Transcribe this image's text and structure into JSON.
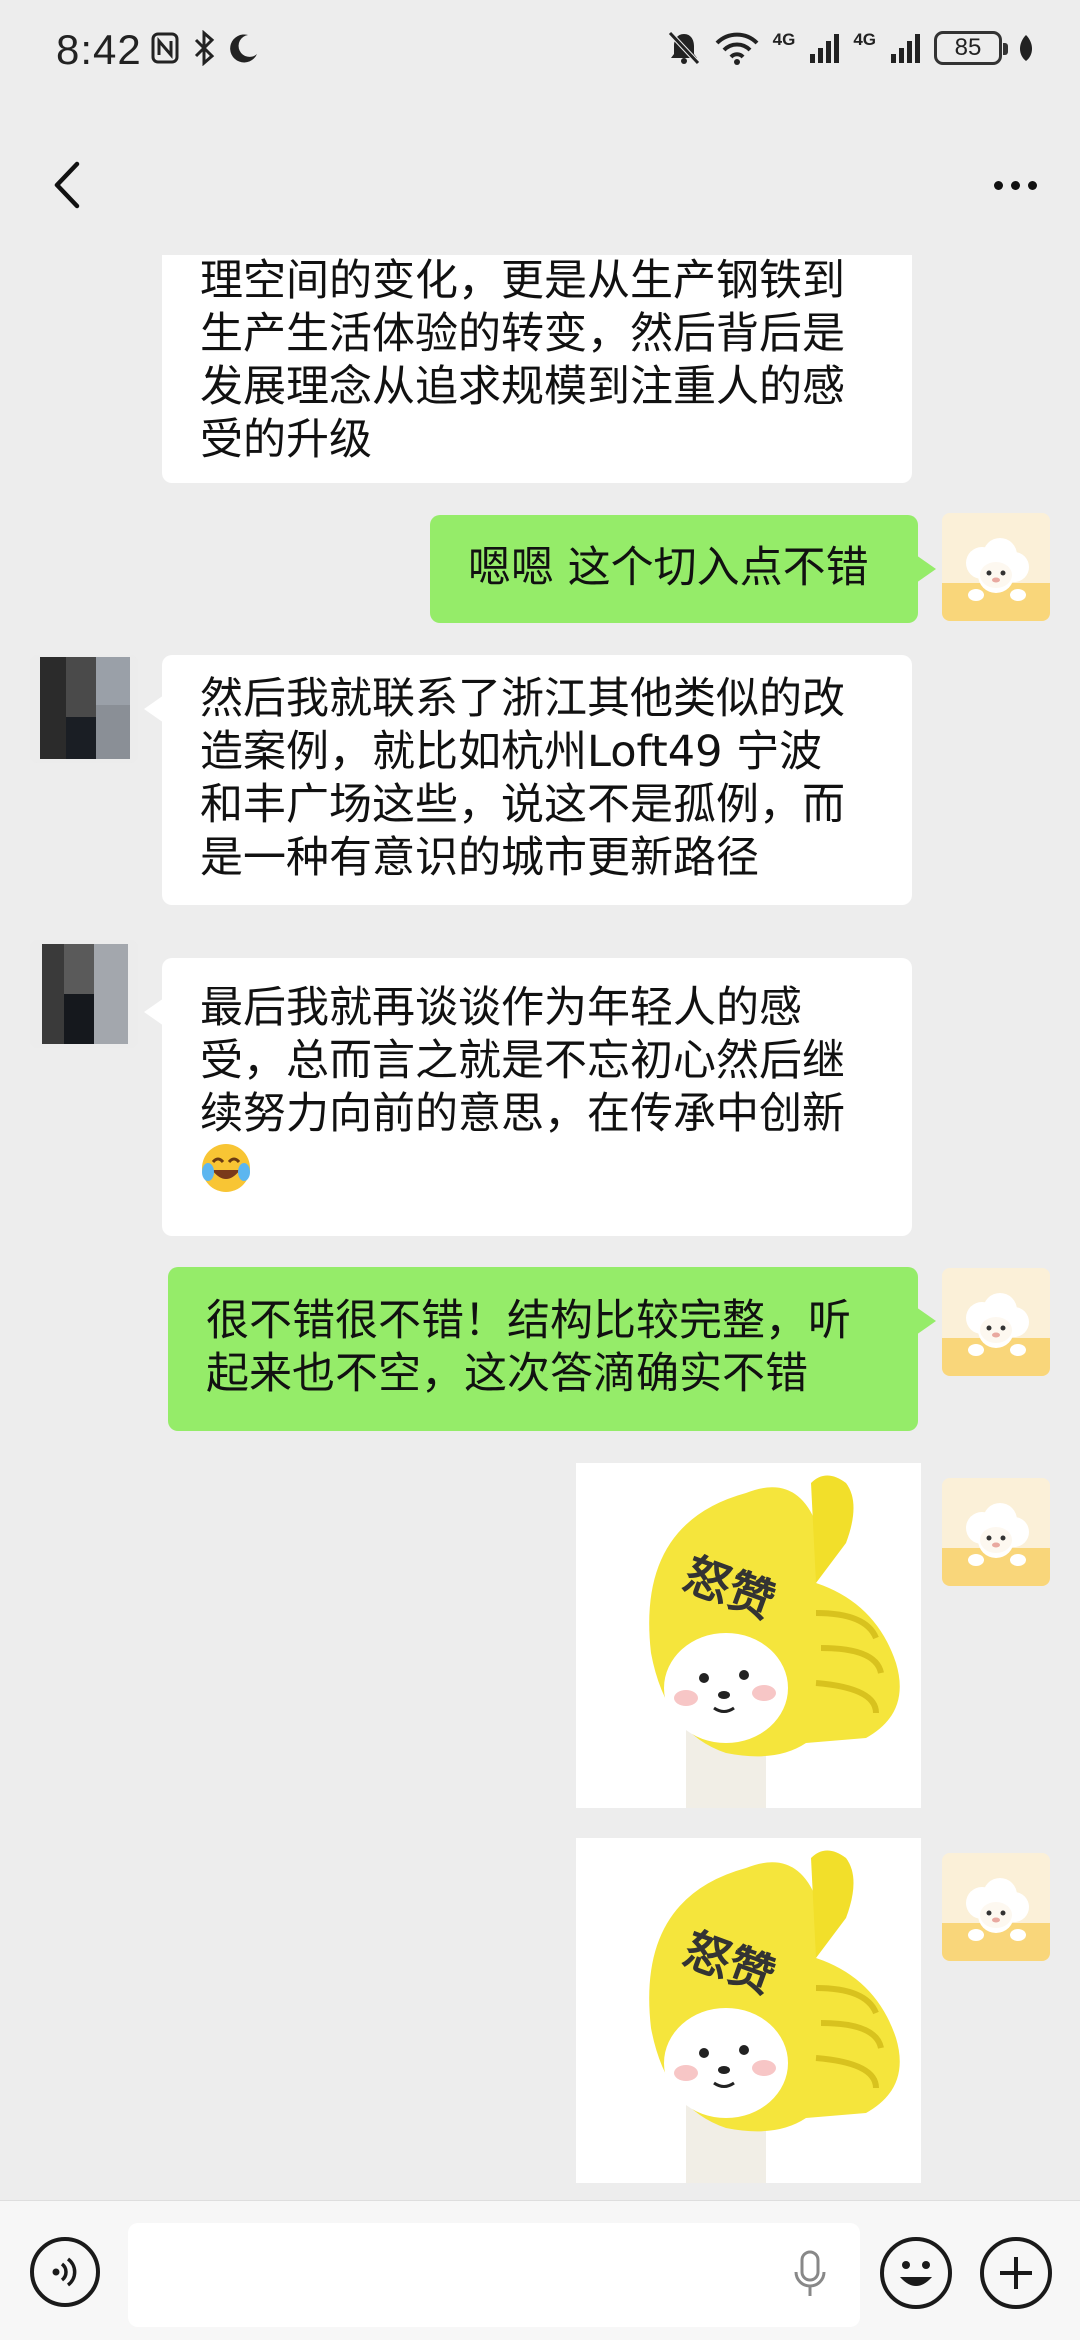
{
  "status_bar": {
    "time": "8:42",
    "network_1": "4G",
    "network_2": "4G",
    "battery": "85"
  },
  "header": {
    "back_icon": "chevron-left-icon",
    "more_icon": "more-dots-icon"
  },
  "messages": [
    {
      "side": "in",
      "lines": [
        "理空间的变化，更是从生产钢铁到",
        "生产生活体验的转变，然后背后是",
        "发展理念从追求规模到注重人的感",
        "受的升级"
      ]
    },
    {
      "side": "out",
      "lines": [
        "嗯嗯 这个切入点不错"
      ]
    },
    {
      "side": "in",
      "lines": [
        "然后我就联系了浙江其他类似的改",
        "造案例，就比如杭州Loft49 宁波",
        "和丰广场这些，说这不是孤例，而",
        "是一种有意识的城市更新路径"
      ]
    },
    {
      "side": "in",
      "lines": [
        "最后我就再谈谈作为年轻人的感",
        "受，总而言之就是不忘初心然后继",
        "续努力向前的意思，在传承中创新"
      ],
      "emoji": "laughing-tears-emoji"
    },
    {
      "side": "out",
      "lines": [
        "很不错很不错！结构比较完整，听",
        "起来也不空，这次答滴确实不错"
      ]
    },
    {
      "side": "out",
      "sticker_text": "怒赞"
    },
    {
      "side": "out",
      "sticker_text": "怒赞"
    }
  ],
  "input_bar": {
    "placeholder": "",
    "voice_icon": "voice-icon",
    "mic_icon": "microphone-icon",
    "emoji_icon": "smiley-icon",
    "plus_icon": "plus-icon"
  }
}
